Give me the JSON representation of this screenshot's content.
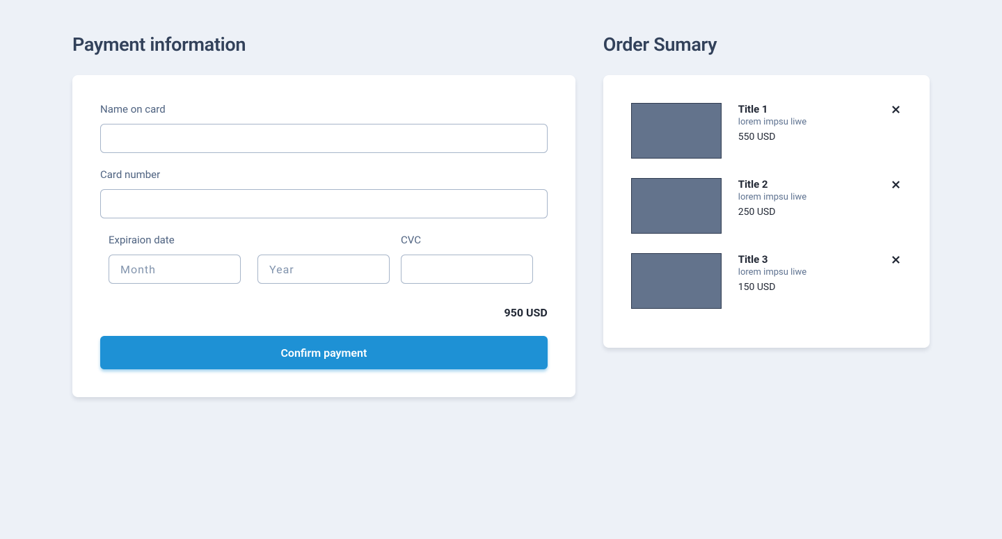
{
  "payment": {
    "section_title": "Payment information",
    "name_label": "Name on card",
    "name_value": "",
    "card_label": "Card number",
    "card_value": "",
    "exp_label": "Expiraion date",
    "month_placeholder": "Month",
    "month_value": "",
    "year_placeholder": "Year",
    "year_value": "",
    "cvc_label": "CVC",
    "cvc_value": "",
    "total": "950 USD",
    "confirm_label": "Confirm payment"
  },
  "summary": {
    "section_title": "Order Sumary",
    "items": [
      {
        "title": "Title 1",
        "subtitle": "lorem impsu liwe",
        "price": "550 USD"
      },
      {
        "title": "Title 2",
        "subtitle": "lorem impsu liwe",
        "price": "250 USD"
      },
      {
        "title": "Title 3",
        "subtitle": "lorem impsu liwe",
        "price": "150 USD"
      }
    ]
  },
  "colors": {
    "primary": "#1e91d5",
    "background": "#edf1f7"
  }
}
